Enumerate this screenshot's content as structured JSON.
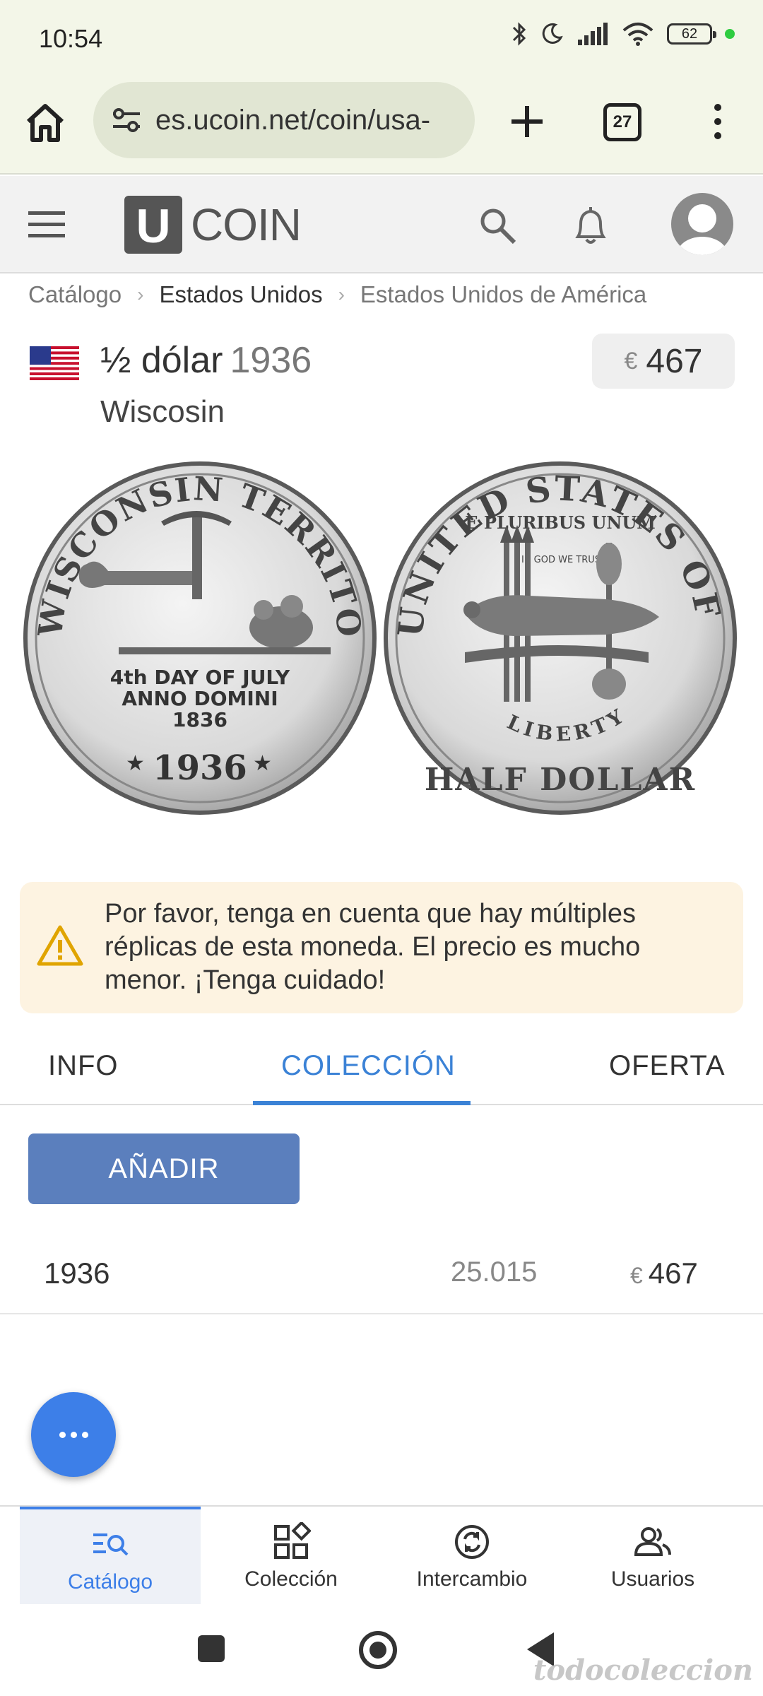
{
  "status_bar": {
    "time": "10:54",
    "battery": "62"
  },
  "browser": {
    "url": "es.ucoin.net/coin/usa-",
    "tab_count": "27"
  },
  "site": {
    "logo_letter": "U",
    "logo_text": "COIN"
  },
  "breadcrumb": [
    "Catálogo",
    "Estados Unidos",
    "Estados Unidos de América"
  ],
  "coin": {
    "title": "½ dólar",
    "year": "1936",
    "subtitle": "Wiscosin",
    "currency": "€",
    "price": "467",
    "obverse_legend": "WISCONSIN TERRITORIAL CENTENNIAL",
    "obverse_date_line1": "4th DAY OF JULY",
    "obverse_date_line2": "ANNO DOMINI",
    "obverse_date_line3": "1836",
    "obverse_year": "1936",
    "reverse_legend": "UNITED STATES OF AMERICA",
    "reverse_motto": "E PLURIBUS UNUM",
    "reverse_god": "IN GOD WE TRUST",
    "reverse_liberty": "LIBERTY",
    "reverse_denomination": "HALF DOLLAR"
  },
  "warning": {
    "text": "Por favor, tenga en cuenta que hay múltiples réplicas de esta moneda. El precio es mucho menor. ¡Tenga cuidado!"
  },
  "tabs": [
    {
      "label": "INFO",
      "active": false
    },
    {
      "label": "COLECCIÓN",
      "active": true
    },
    {
      "label": "OFERTA",
      "active": false
    }
  ],
  "collection": {
    "add_label": "AÑADIR",
    "rows": [
      {
        "year": "1936",
        "mintage": "25.015",
        "currency": "€",
        "price": "467"
      }
    ]
  },
  "bottom_nav": [
    {
      "label": "Catálogo",
      "icon": "catalog-search-icon",
      "active": true
    },
    {
      "label": "Colección",
      "icon": "collection-grid-icon",
      "active": false
    },
    {
      "label": "Intercambio",
      "icon": "exchange-icon",
      "active": false
    },
    {
      "label": "Usuarios",
      "icon": "users-icon",
      "active": false
    }
  ],
  "watermark": "todocoleccion",
  "colors": {
    "accent": "#3b82d6",
    "add_button": "#5b7fbd",
    "warning_bg": "#fdf3e1",
    "chrome_bg": "#f3f6e8"
  }
}
